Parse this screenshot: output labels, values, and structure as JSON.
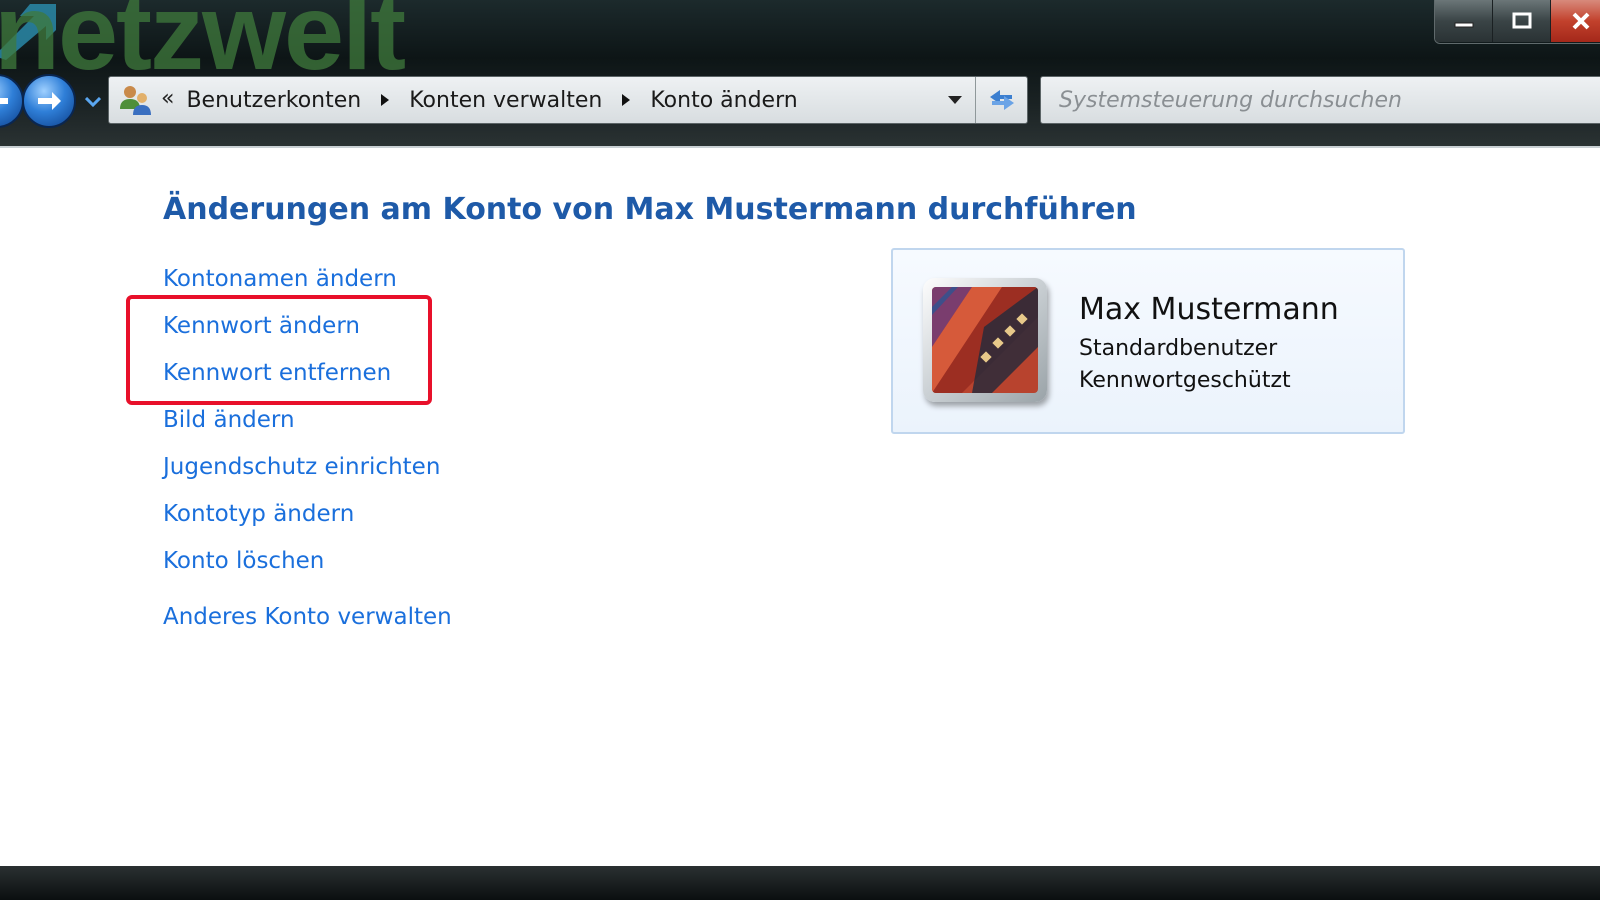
{
  "window": {
    "watermark_text": "netzwelt",
    "controls": {
      "minimize_icon": "minimize-icon",
      "maximize_icon": "maximize-icon",
      "close_icon": "close-icon"
    }
  },
  "navigation": {
    "back_icon": "back-arrow-icon",
    "forward_icon": "forward-arrow-icon",
    "recent_icon": "chevron-down-icon"
  },
  "address_bar": {
    "overflow": "«",
    "breadcrumbs": [
      "Benutzerkonten",
      "Konten verwalten",
      "Konto ändern"
    ],
    "refresh_icon": "refresh-icon"
  },
  "search": {
    "placeholder": "Systemsteuerung durchsuchen"
  },
  "main": {
    "title": "Änderungen am Konto von Max Mustermann durchführen",
    "tasks": [
      "Kontonamen ändern",
      "Kennwort ändern",
      "Kennwort entfernen",
      "Bild ändern",
      "Jugendschutz einrichten",
      "Kontotyp ändern",
      "Konto löschen"
    ],
    "other_account": "Anderes Konto verwalten"
  },
  "account": {
    "name": "Max Mustermann",
    "type": "Standardbenutzer",
    "status": "Kennwortgeschützt"
  },
  "colors": {
    "link": "#1a6fdc",
    "title": "#1e5aa8",
    "highlight": "#e8102a",
    "card_border": "#c0d6ee"
  }
}
